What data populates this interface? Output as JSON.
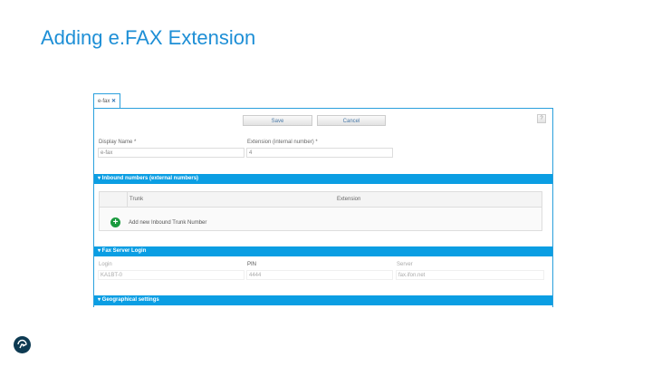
{
  "slide_title": "Adding e.FAX Extension",
  "tab": {
    "label": "e-fax",
    "close": "✕"
  },
  "toolbar": {
    "save": "Save",
    "cancel": "Cancel",
    "help": "?"
  },
  "form": {
    "display_name_label": "Display Name *",
    "display_name_value": "e-fax",
    "extension_label": "Extension (internal number) *",
    "extension_value": "4"
  },
  "sections": {
    "inbound": "▾ Inbound numbers (external numbers)",
    "fax": "▾ Fax Server Login",
    "geo": "▾ Geographical settings"
  },
  "table": {
    "columns": [
      "Trunk",
      "Extension"
    ],
    "add_label": "Add new Inbound Trunk Number"
  },
  "fax": {
    "login_label": "Login",
    "login_value": "KA1BT-0",
    "pin_label": "PIN",
    "pin_value": "4444",
    "server_label": "Server",
    "server_value": "fax.ifon.net"
  }
}
